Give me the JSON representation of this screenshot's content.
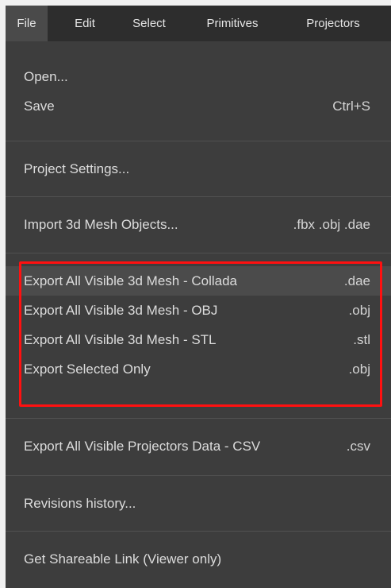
{
  "menubar": {
    "items": [
      {
        "label": "File"
      },
      {
        "label": "Edit"
      },
      {
        "label": "Select"
      },
      {
        "label": "Primitives"
      },
      {
        "label": "Projectors"
      }
    ]
  },
  "file_menu": {
    "open": {
      "label": "Open..."
    },
    "save": {
      "label": "Save",
      "shortcut": "Ctrl+S"
    },
    "project_settings": {
      "label": "Project Settings..."
    },
    "import_mesh": {
      "label": "Import 3d Mesh Objects...",
      "shortcut": ".fbx .obj .dae"
    },
    "export_collada": {
      "label": "Export All Visible 3d Mesh - Collada",
      "shortcut": ".dae"
    },
    "export_obj": {
      "label": "Export All Visible 3d Mesh - OBJ",
      "shortcut": ".obj"
    },
    "export_stl": {
      "label": "Export All Visible 3d Mesh - STL",
      "shortcut": ".stl"
    },
    "export_selected": {
      "label": "Export Selected Only",
      "shortcut": ".obj"
    },
    "export_projectors_csv": {
      "label": "Export All Visible Projectors Data - CSV",
      "shortcut": ".csv"
    },
    "revisions_history": {
      "label": "Revisions history..."
    },
    "shareable_link": {
      "label": "Get Shareable Link (Viewer only)"
    }
  },
  "colors": {
    "annotation_highlight": "#ff1010",
    "menu_background": "#3d3d3d",
    "menubar_background": "#2d2d2d",
    "hover_background": "#4b4b4b"
  }
}
